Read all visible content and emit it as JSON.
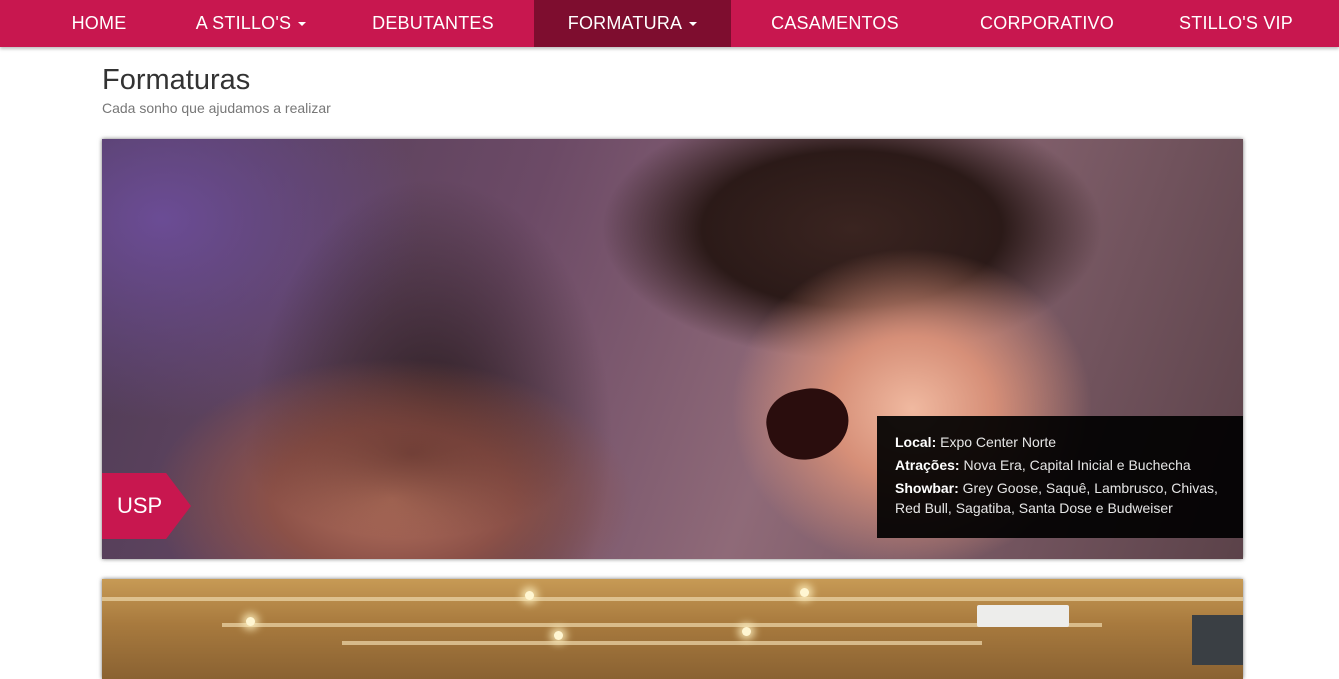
{
  "nav": {
    "items": [
      {
        "label": "HOME",
        "dropdown": false,
        "active": false
      },
      {
        "label": "A STILLO'S",
        "dropdown": true,
        "active": false
      },
      {
        "label": "DEBUTANTES",
        "dropdown": false,
        "active": false
      },
      {
        "label": "FORMATURA",
        "dropdown": true,
        "active": true
      },
      {
        "label": "CASAMENTOS",
        "dropdown": false,
        "active": false
      },
      {
        "label": "CORPORATIVO",
        "dropdown": false,
        "active": false
      },
      {
        "label": "STILLO'S VIP",
        "dropdown": false,
        "active": false
      }
    ]
  },
  "page": {
    "title": "Formaturas",
    "subtitle": "Cada sonho que ajudamos a realizar"
  },
  "cards": [
    {
      "tag": "USP",
      "info": {
        "local_label": "Local:",
        "local_value": "Expo Center Norte",
        "atracoes_label": "Atrações:",
        "atracoes_value": "Nova Era, Capital Inicial e Buchecha",
        "showbar_label": "Showbar:",
        "showbar_value": "Grey Goose, Saquê, Lambrusco, Chivas, Red Bull, Sagatiba, Santa Dose e Budweiser"
      }
    }
  ],
  "colors": {
    "brand": "#c8174f",
    "nav_active": "#7e0d2f"
  }
}
